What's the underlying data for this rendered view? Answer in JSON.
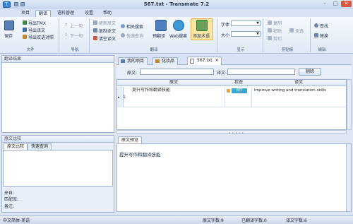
{
  "window": {
    "title": "567.txt - Transmate 7.2",
    "minimize": "–",
    "maximize": "□",
    "close": "✕"
  },
  "menus": [
    "项目",
    "翻译",
    "语料管理",
    "设置",
    "帮助"
  ],
  "ribbon": {
    "file": {
      "save": "保存",
      "export_tmx": "导出TMX",
      "export_translation": "导出译文",
      "export_bilingual": "导出双语对照",
      "group": "文件"
    },
    "nav": {
      "prev": "上一句",
      "next": "下一句",
      "group": "导航"
    },
    "translate": {
      "update_source": "更新原文",
      "copy_source": "复制全文",
      "clear_translation": "清空译文",
      "related_search": "相关搜索",
      "quick_search": "快速查询",
      "pretranslate": "预翻译",
      "web_search": "Web搜索",
      "add_term": "添加术语",
      "group": "翻译"
    },
    "display": {
      "font_label": "字体",
      "size_label": "大小",
      "group": "显示"
    },
    "clipboard": {
      "copy": "复制",
      "paste": "粘贴",
      "cut": "剪切",
      "select_all": "全选",
      "group": "剪贴板"
    },
    "edit": {
      "find": "查找",
      "replace": "替换",
      "group": "编辑"
    }
  },
  "left": {
    "results_title": "翻译结果",
    "compare_title": "原文比较",
    "tab_compare": "原文比较",
    "tab_quick": "快速查询",
    "source_label": "来自:",
    "translator_label": "匹配库:",
    "note_label": "备注:"
  },
  "doc_tabs": [
    "我的项目",
    "化妆品",
    "567.txt"
  ],
  "filter": {
    "source_label": "原文:",
    "target_label": "译文:",
    "delete": "删除"
  },
  "grid": {
    "headers": [
      "原文",
      "状态",
      "译文"
    ],
    "rows": [
      {
        "num": "1",
        "source": "提升写作和翻译技能",
        "status": "MT",
        "target": "Improve writing and translation skills"
      }
    ]
  },
  "preview": {
    "tab": "原文预览",
    "text": "提升写作和翻译技能"
  },
  "status": {
    "language": "中文简体-英语",
    "source_count": "原文字数:9",
    "translated_count": "已翻译字数:0",
    "target_count": "译文字数:6"
  },
  "colors": {
    "accent": "#3e83cf",
    "mt_badge": "#3fa7c9"
  }
}
